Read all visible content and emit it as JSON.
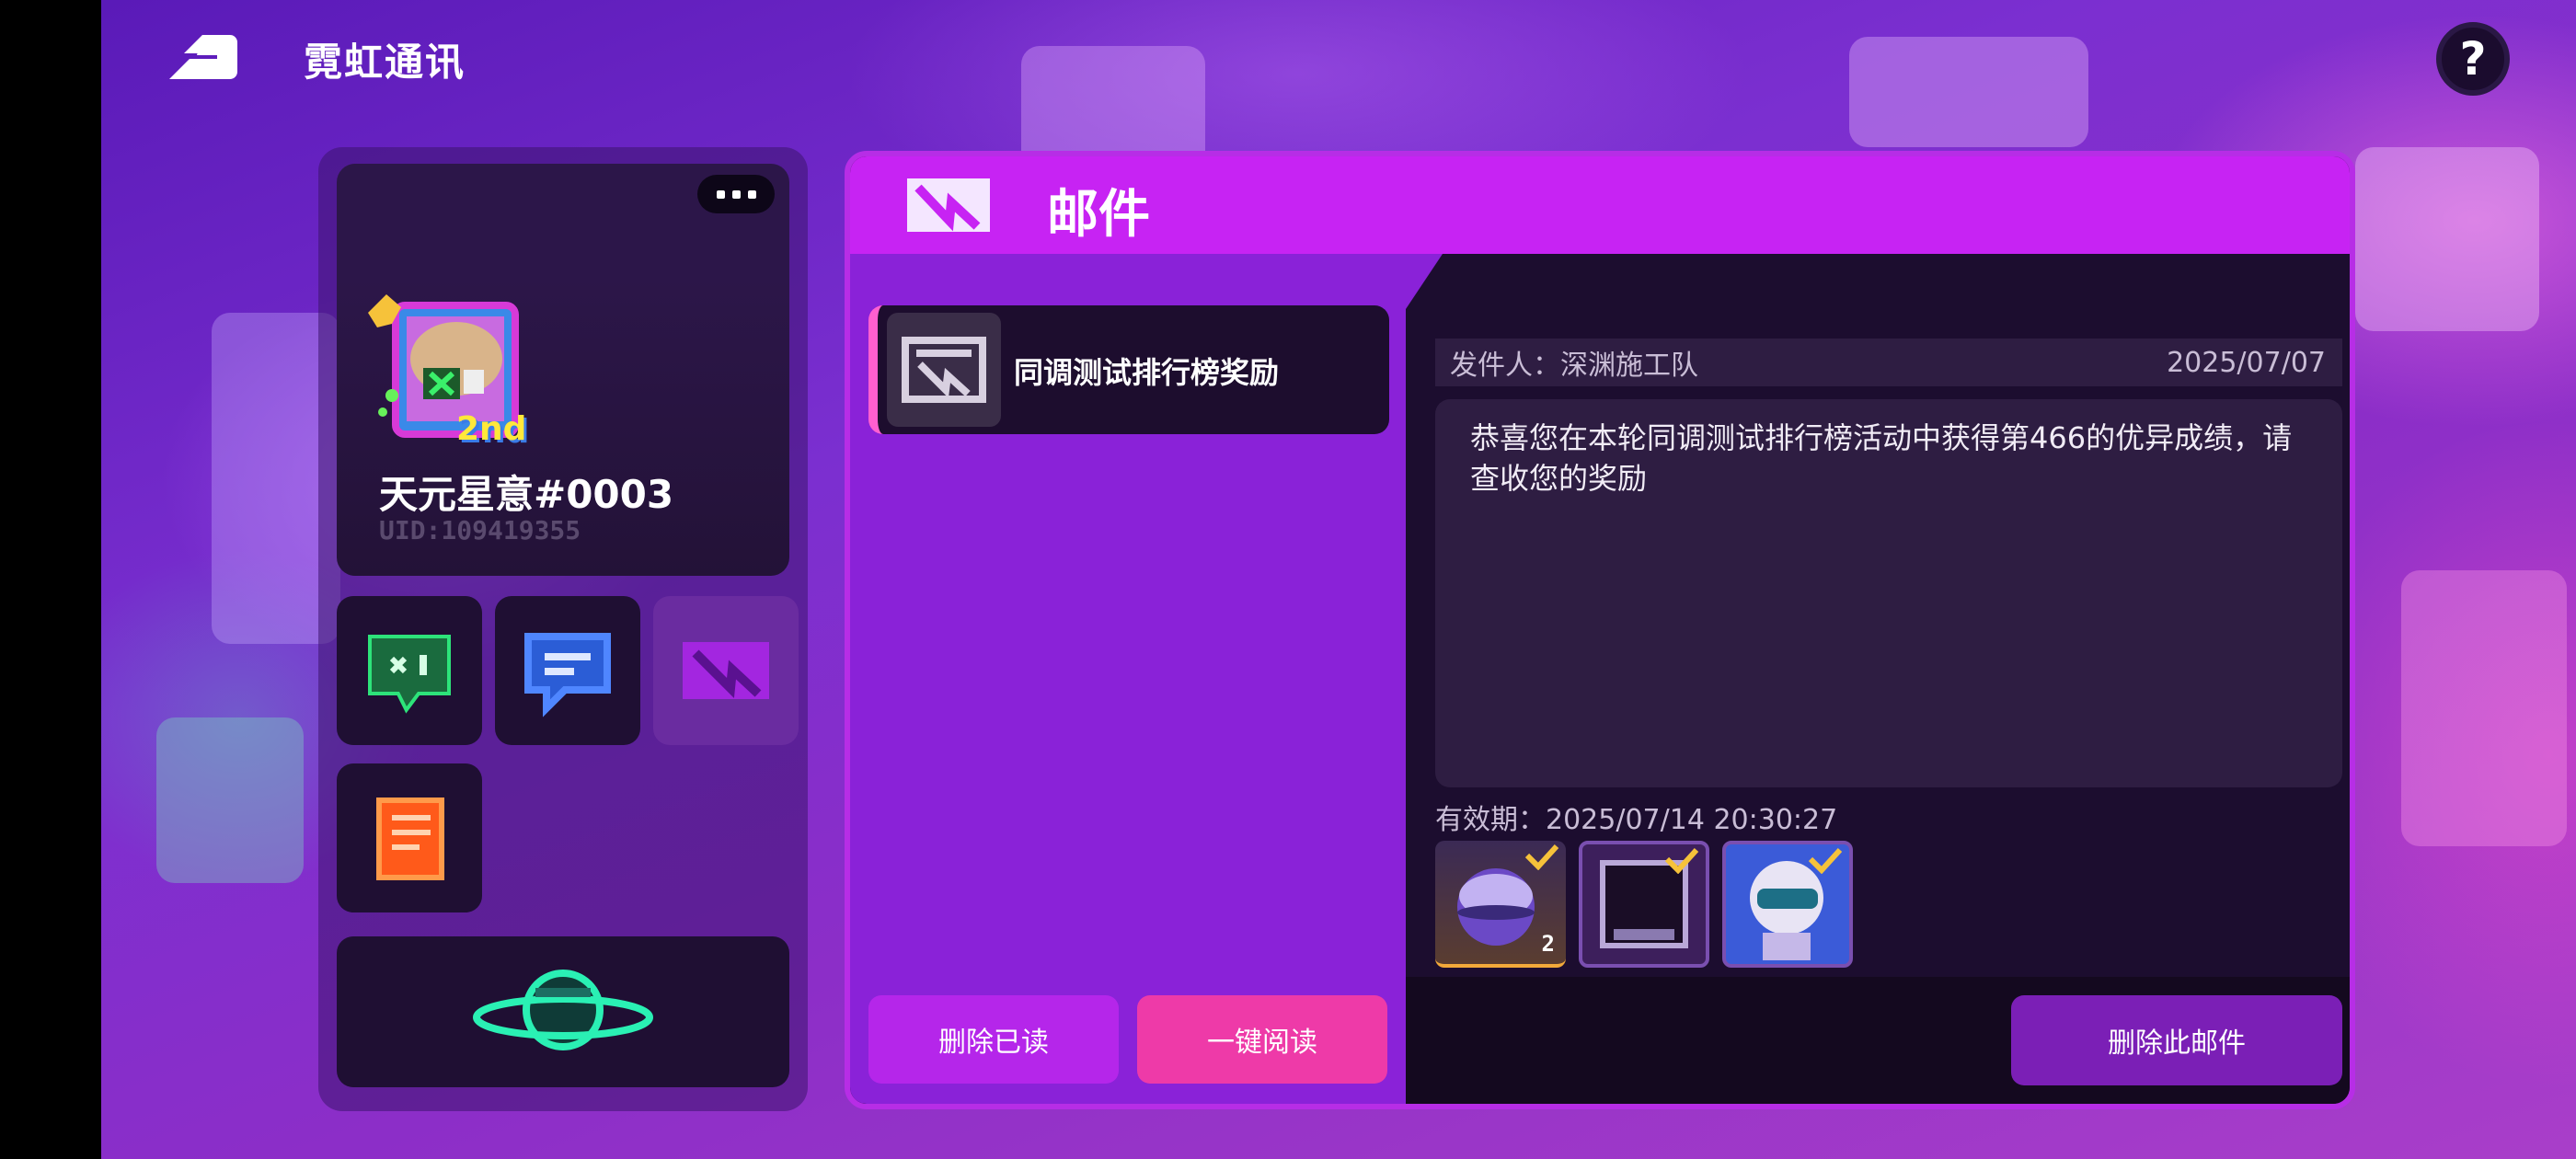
{
  "header": {
    "title": "霓虹通讯",
    "help_label": "?"
  },
  "profile": {
    "name": "天元星意#0003",
    "uid": "UID:109419355",
    "rank_badge": "2nd"
  },
  "side_tiles": [
    {
      "icon": "neon-cat-icon",
      "color": "#2de37a"
    },
    {
      "icon": "chat-bubble-icon",
      "color": "#3b6cff"
    },
    {
      "icon": "mail-icon",
      "color": "#a326e0"
    },
    {
      "icon": "notebook-icon",
      "color": "#ff5a1a"
    },
    {
      "icon": "planet-icon",
      "color": "#2af0b4"
    }
  ],
  "mail": {
    "panel_title": "邮件",
    "items": [
      {
        "title": "同调测试排行榜奖励"
      }
    ],
    "buttons": {
      "delete_read": "删除已读",
      "read_all": "一键阅读",
      "delete_this": "删除此邮件"
    }
  },
  "detail": {
    "sender_label": "发件人：",
    "sender": "深渊施工队",
    "date": "2025/07/07",
    "body": "恭喜您在本轮同调测试排行榜活动中获得第466的优异成绩，请查收您的奖励",
    "expiry_label": "有效期：",
    "expiry": "2025/07/14 20:30:27",
    "rewards": [
      {
        "icon": "purple-orb-icon",
        "qty": "2",
        "claimed": true
      },
      {
        "icon": "frame-item-icon",
        "qty": "",
        "claimed": true
      },
      {
        "icon": "helmet-character-icon",
        "qty": "",
        "claimed": true
      }
    ]
  },
  "colors": {
    "accent_magenta": "#c723f3",
    "button_pink": "#ee3aa8",
    "button_purple": "#b526ea"
  }
}
